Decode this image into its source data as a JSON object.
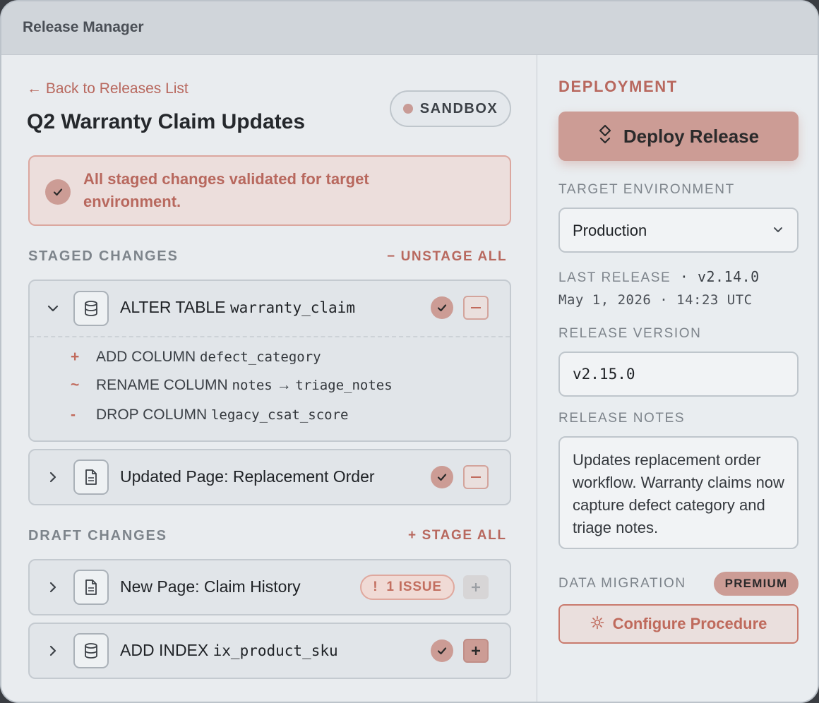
{
  "app": {
    "title": "Release Manager"
  },
  "header": {
    "back_link": "← Back to Releases List",
    "title": "Q2 Warranty Claim Updates",
    "environment_badge": "SANDBOX"
  },
  "banner": {
    "message": "All staged changes validated for target environment."
  },
  "staged": {
    "heading": "STAGED CHANGES",
    "action_symbol": "−",
    "action_label": "UNSTAGE ALL",
    "items": [
      {
        "label_prefix": "ALTER TABLE",
        "label_code": "warranty_claim",
        "icon": "database-icon",
        "expanded": true,
        "sub": [
          {
            "symbol": "+",
            "text": "ADD COLUMN",
            "code": "defect_category",
            "extra": "",
            "extra_code": ""
          },
          {
            "symbol": "~",
            "text": "RENAME COLUMN",
            "code": "notes",
            "extra": " → ",
            "extra_code": "triage_notes"
          },
          {
            "symbol": "-",
            "text": "DROP COLUMN",
            "code": "legacy_csat_score",
            "extra": "",
            "extra_code": ""
          }
        ]
      },
      {
        "label": "Updated Page: Replacement Order",
        "icon": "page-icon",
        "expanded": false
      }
    ]
  },
  "draft": {
    "heading": "DRAFT CHANGES",
    "action_symbol": "+",
    "action_label": "STAGE ALL",
    "items": [
      {
        "label": "New Page: Claim History",
        "icon": "page-icon",
        "issue_symbol": "!",
        "issue_label": "1 ISSUE"
      },
      {
        "label_prefix": "ADD INDEX",
        "label_code": "ix_product_sku",
        "icon": "database-icon"
      }
    ]
  },
  "deployment": {
    "heading": "DEPLOYMENT",
    "deploy_label": "Deploy Release",
    "target_env_label": "TARGET ENVIRONMENT",
    "target_env_value": "Production",
    "last_release_label": "LAST RELEASE",
    "last_release_sep": " · ",
    "last_release_version": "v2.14.0",
    "last_release_date": "May 1, 2026 · 14:23 UTC",
    "release_version_label": "RELEASE VERSION",
    "release_version_value": "v2.15.0",
    "release_notes_label": "RELEASE NOTES",
    "release_notes_value": "Updates replacement order workflow. Warranty claims now capture defect category and triage notes.",
    "data_migration_label": "DATA MIGRATION",
    "premium_badge": "PREMIUM",
    "configure_label": "Configure Procedure"
  },
  "colors": {
    "accent": "#b8685e",
    "accent_fill": "#cc9c95",
    "panel": "#e9ecef"
  }
}
